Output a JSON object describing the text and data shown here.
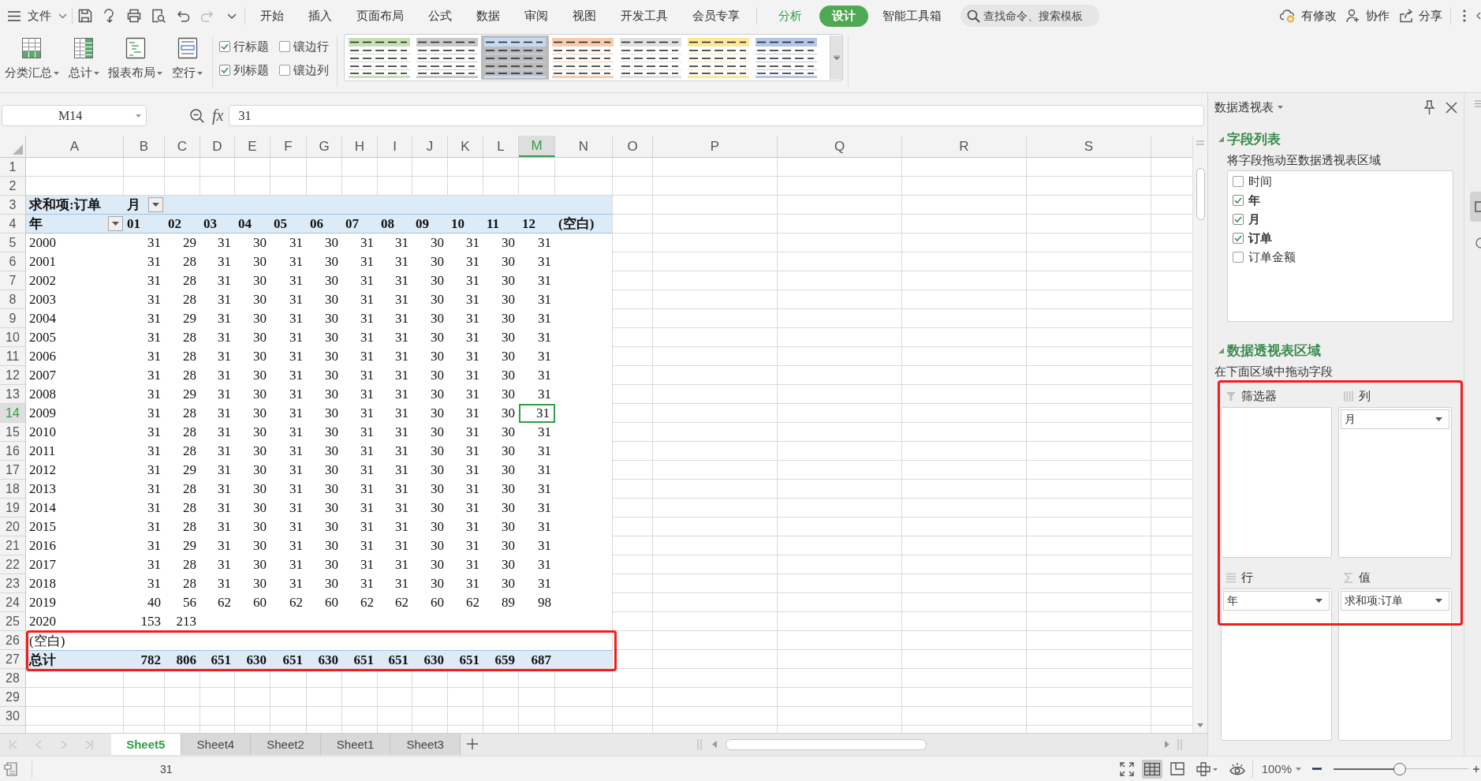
{
  "menu_bar": {
    "file_menu": "文件",
    "tabs": [
      {
        "label": "开始",
        "kind": "main",
        "selected": false
      },
      {
        "label": "插入",
        "kind": "main",
        "selected": false
      },
      {
        "label": "页面布局",
        "kind": "main",
        "selected": false
      },
      {
        "label": "公式",
        "kind": "main",
        "selected": false
      },
      {
        "label": "数据",
        "kind": "main",
        "selected": false
      },
      {
        "label": "审阅",
        "kind": "main",
        "selected": false
      },
      {
        "label": "视图",
        "kind": "main",
        "selected": false
      },
      {
        "label": "开发工具",
        "kind": "main",
        "selected": false
      },
      {
        "label": "会员专享",
        "kind": "main",
        "selected": false
      },
      {
        "label": "分析",
        "kind": "context",
        "selected": false
      },
      {
        "label": "设计",
        "kind": "context",
        "selected": true
      },
      {
        "label": "智能工具箱",
        "kind": "main",
        "selected": false
      }
    ],
    "search": {
      "placeholder": "查找命令、搜索模板"
    },
    "actions": [
      {
        "label": "有修改",
        "kind": "cloud"
      },
      {
        "label": "协作",
        "kind": "collaborate"
      },
      {
        "label": "分享",
        "kind": "share"
      }
    ]
  },
  "ribbon": {
    "buttons": [
      {
        "label": "分类汇总",
        "kind": "subtotal"
      },
      {
        "label": "总计",
        "kind": "grand-total"
      },
      {
        "label": "报表布局",
        "kind": "layout"
      },
      {
        "label": "空行",
        "kind": "blank-row"
      }
    ],
    "options": [
      {
        "label": "行标题",
        "checked": true
      },
      {
        "label": "镶边行",
        "checked": false
      },
      {
        "label": "列标题",
        "checked": true
      },
      {
        "label": "镶边列",
        "checked": false
      }
    ],
    "table_styles": [
      {
        "color": "#c6e0b4",
        "selected": false
      },
      {
        "color": "#c9c9c9",
        "selected": false
      },
      {
        "color": "#c5d9f1",
        "selected": true
      },
      {
        "color": "#f8cbad",
        "selected": false
      },
      {
        "color": "#e0e0e0",
        "selected": false
      },
      {
        "color": "#ffe699",
        "selected": false
      },
      {
        "color": "#b4c6e7",
        "selected": false
      }
    ]
  },
  "formula_bar": {
    "cell_reference": "M14",
    "function_label": "fx",
    "value": "31"
  },
  "sheet": {
    "columns": [
      {
        "label": "A",
        "selected": false
      },
      {
        "label": "B",
        "selected": false
      },
      {
        "label": "C",
        "selected": false
      },
      {
        "label": "D",
        "selected": false
      },
      {
        "label": "E",
        "selected": false
      },
      {
        "label": "F",
        "selected": false
      },
      {
        "label": "G",
        "selected": false
      },
      {
        "label": "H",
        "selected": false
      },
      {
        "label": "I",
        "selected": false
      },
      {
        "label": "J",
        "selected": false
      },
      {
        "label": "K",
        "selected": false
      },
      {
        "label": "L",
        "selected": false
      },
      {
        "label": "M",
        "selected": true
      },
      {
        "label": "N",
        "selected": false
      },
      {
        "label": "O",
        "selected": false
      },
      {
        "label": "P",
        "selected": false
      },
      {
        "label": "Q",
        "selected": false
      },
      {
        "label": "R",
        "selected": false
      },
      {
        "label": "S",
        "selected": false
      }
    ],
    "row_numbers": [
      {
        "label": "1",
        "selected": false
      },
      {
        "label": "2",
        "selected": false
      },
      {
        "label": "3",
        "selected": false
      },
      {
        "label": "4",
        "selected": false
      },
      {
        "label": "5",
        "selected": false
      },
      {
        "label": "6",
        "selected": false
      },
      {
        "label": "7",
        "selected": false
      },
      {
        "label": "8",
        "selected": false
      },
      {
        "label": "9",
        "selected": false
      },
      {
        "label": "10",
        "selected": false
      },
      {
        "label": "11",
        "selected": false
      },
      {
        "label": "12",
        "selected": false
      },
      {
        "label": "13",
        "selected": false
      },
      {
        "label": "14",
        "selected": true
      },
      {
        "label": "15",
        "selected": false
      },
      {
        "label": "16",
        "selected": false
      },
      {
        "label": "17",
        "selected": false
      },
      {
        "label": "18",
        "selected": false
      },
      {
        "label": "19",
        "selected": false
      },
      {
        "label": "20",
        "selected": false
      },
      {
        "label": "21",
        "selected": false
      },
      {
        "label": "22",
        "selected": false
      },
      {
        "label": "23",
        "selected": false
      },
      {
        "label": "24",
        "selected": false
      },
      {
        "label": "25",
        "selected": false
      },
      {
        "label": "26",
        "selected": false
      },
      {
        "label": "27",
        "selected": false
      },
      {
        "label": "28",
        "selected": false
      },
      {
        "label": "29",
        "selected": false
      },
      {
        "label": "30",
        "selected": false
      }
    ]
  },
  "pivot_table": {
    "title": "求和项:订单",
    "column_field": "月",
    "row_field": "年",
    "column_labels": [
      "01",
      "02",
      "03",
      "04",
      "05",
      "06",
      "07",
      "08",
      "09",
      "10",
      "11",
      "12",
      "(空白)"
    ],
    "rows": [
      {
        "label": "2000",
        "values": [
          "31",
          "29",
          "31",
          "30",
          "31",
          "30",
          "31",
          "31",
          "30",
          "31",
          "30",
          "31"
        ]
      },
      {
        "label": "2001",
        "values": [
          "31",
          "28",
          "31",
          "30",
          "31",
          "30",
          "31",
          "31",
          "30",
          "31",
          "30",
          "31"
        ]
      },
      {
        "label": "2002",
        "values": [
          "31",
          "28",
          "31",
          "30",
          "31",
          "30",
          "31",
          "31",
          "30",
          "31",
          "30",
          "31"
        ]
      },
      {
        "label": "2003",
        "values": [
          "31",
          "28",
          "31",
          "30",
          "31",
          "30",
          "31",
          "31",
          "30",
          "31",
          "30",
          "31"
        ]
      },
      {
        "label": "2004",
        "values": [
          "31",
          "29",
          "31",
          "30",
          "31",
          "30",
          "31",
          "31",
          "30",
          "31",
          "30",
          "31"
        ]
      },
      {
        "label": "2005",
        "values": [
          "31",
          "28",
          "31",
          "30",
          "31",
          "30",
          "31",
          "31",
          "30",
          "31",
          "30",
          "31"
        ]
      },
      {
        "label": "2006",
        "values": [
          "31",
          "28",
          "31",
          "30",
          "31",
          "30",
          "31",
          "31",
          "30",
          "31",
          "30",
          "31"
        ]
      },
      {
        "label": "2007",
        "values": [
          "31",
          "28",
          "31",
          "30",
          "31",
          "30",
          "31",
          "31",
          "30",
          "31",
          "30",
          "31"
        ]
      },
      {
        "label": "2008",
        "values": [
          "31",
          "29",
          "31",
          "30",
          "31",
          "30",
          "31",
          "31",
          "30",
          "31",
          "30",
          "31"
        ]
      },
      {
        "label": "2009",
        "values": [
          "31",
          "28",
          "31",
          "30",
          "31",
          "30",
          "31",
          "31",
          "30",
          "31",
          "30",
          "31"
        ]
      },
      {
        "label": "2010",
        "values": [
          "31",
          "28",
          "31",
          "30",
          "31",
          "30",
          "31",
          "31",
          "30",
          "31",
          "30",
          "31"
        ]
      },
      {
        "label": "2011",
        "values": [
          "31",
          "28",
          "31",
          "30",
          "31",
          "30",
          "31",
          "31",
          "30",
          "31",
          "30",
          "31"
        ]
      },
      {
        "label": "2012",
        "values": [
          "31",
          "29",
          "31",
          "30",
          "31",
          "30",
          "31",
          "31",
          "30",
          "31",
          "30",
          "31"
        ]
      },
      {
        "label": "2013",
        "values": [
          "31",
          "28",
          "31",
          "30",
          "31",
          "30",
          "31",
          "31",
          "30",
          "31",
          "30",
          "31"
        ]
      },
      {
        "label": "2014",
        "values": [
          "31",
          "28",
          "31",
          "30",
          "31",
          "30",
          "31",
          "31",
          "30",
          "31",
          "30",
          "31"
        ]
      },
      {
        "label": "2015",
        "values": [
          "31",
          "28",
          "31",
          "30",
          "31",
          "30",
          "31",
          "31",
          "30",
          "31",
          "30",
          "31"
        ]
      },
      {
        "label": "2016",
        "values": [
          "31",
          "29",
          "31",
          "30",
          "31",
          "30",
          "31",
          "31",
          "30",
          "31",
          "30",
          "31"
        ]
      },
      {
        "label": "2017",
        "values": [
          "31",
          "28",
          "31",
          "30",
          "31",
          "30",
          "31",
          "31",
          "30",
          "31",
          "30",
          "31"
        ]
      },
      {
        "label": "2018",
        "values": [
          "31",
          "28",
          "31",
          "30",
          "31",
          "30",
          "31",
          "31",
          "30",
          "31",
          "30",
          "31"
        ]
      },
      {
        "label": "2019",
        "values": [
          "40",
          "56",
          "62",
          "60",
          "62",
          "60",
          "62",
          "62",
          "60",
          "62",
          "89",
          "98"
        ]
      },
      {
        "label": "2020",
        "values": [
          "153",
          "213"
        ]
      },
      {
        "label": "(空白)"
      }
    ],
    "total": {
      "label": "总计",
      "values": [
        "782",
        "806",
        "651",
        "630",
        "651",
        "630",
        "651",
        "651",
        "630",
        "651",
        "659",
        "687"
      ]
    }
  },
  "sheet_tabs": [
    {
      "label": "Sheet5",
      "selected": true
    },
    {
      "label": "Sheet4",
      "selected": false
    },
    {
      "label": "Sheet2",
      "selected": false
    },
    {
      "label": "Sheet1",
      "selected": false
    },
    {
      "label": "Sheet3",
      "selected": false
    }
  ],
  "pivot_panel": {
    "title": "数据透视表",
    "field_list": {
      "heading": "字段列表",
      "hint": "将字段拖动至数据透视表区域",
      "fields": [
        {
          "label": "时间",
          "checked": false
        },
        {
          "label": "年",
          "checked": true
        },
        {
          "label": "月",
          "checked": true
        },
        {
          "label": "订单",
          "checked": true
        },
        {
          "label": "订单金额",
          "checked": false
        }
      ]
    },
    "areas": {
      "heading": "数据透视表区域",
      "hint": "在下面区域中拖动字段",
      "zones": [
        {
          "label": "筛选器",
          "kind": "filter"
        },
        {
          "label": "列",
          "kind": "columns",
          "items": [
            "月"
          ]
        },
        {
          "label": "行",
          "kind": "rows",
          "items": [
            "年"
          ]
        },
        {
          "label": "值",
          "kind": "values",
          "items": [
            "求和项:订单"
          ]
        }
      ]
    }
  },
  "status_bar": {
    "value": "31",
    "view_buttons": [
      {
        "kind": "fullscreen",
        "selected": false
      },
      {
        "kind": "normal",
        "selected": true
      },
      {
        "kind": "page-layout",
        "selected": false
      },
      {
        "kind": "page-break",
        "selected": false
      },
      {
        "kind": "eye-protection",
        "selected": false
      }
    ],
    "zoom": "100%",
    "zoom_slider": {
      "level": 0.49
    }
  }
}
